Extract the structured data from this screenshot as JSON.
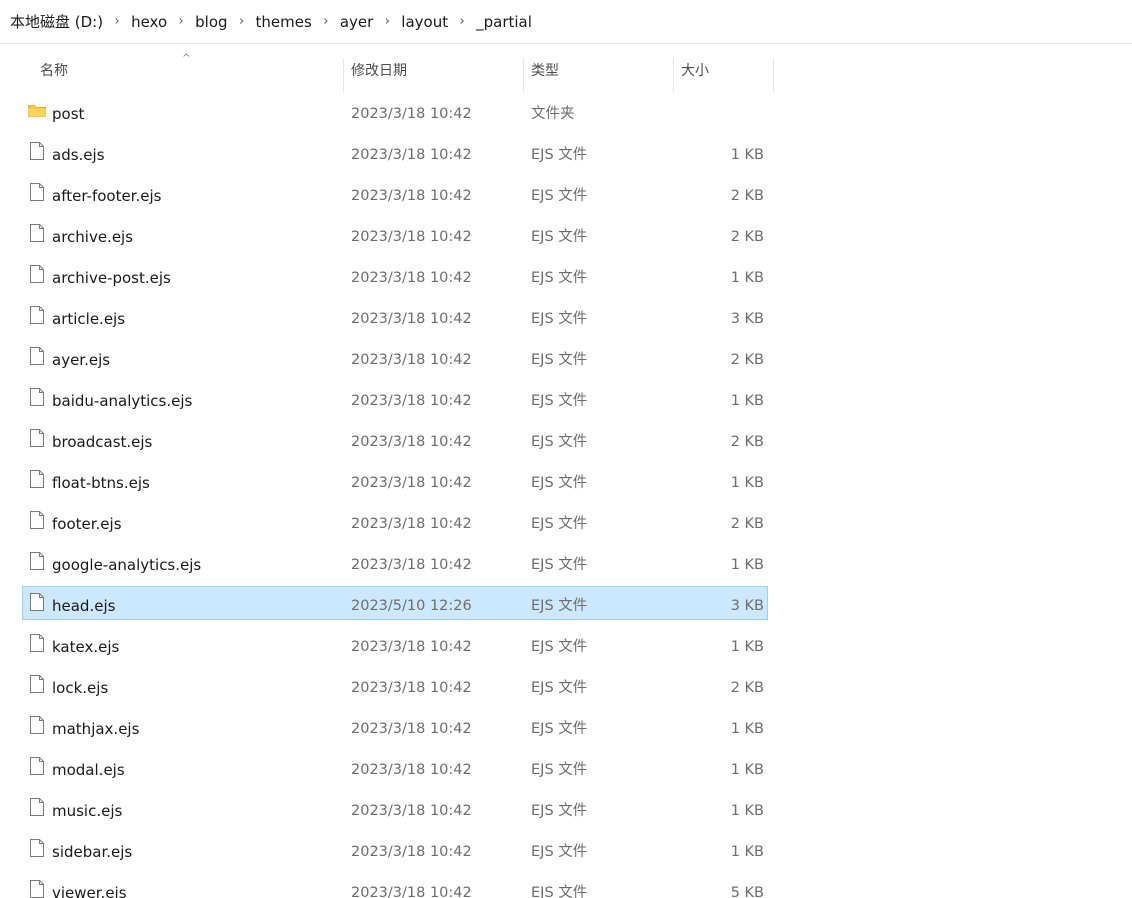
{
  "breadcrumb": {
    "items": [
      "本地磁盘 (D:)",
      "hexo",
      "blog",
      "themes",
      "ayer",
      "layout",
      "_partial"
    ],
    "separator": "›"
  },
  "columns": {
    "name": "名称",
    "date": "修改日期",
    "type": "类型",
    "size": "大小",
    "sort_indicator": "^"
  },
  "colors": {
    "selection_bg": "#cce8ff",
    "selection_border": "#99d1ff",
    "folder": "#f8c644"
  },
  "files": [
    {
      "name": "post",
      "date": "2023/3/18 10:42",
      "type": "文件夹",
      "size": "",
      "icon": "folder-icon"
    },
    {
      "name": "ads.ejs",
      "date": "2023/3/18 10:42",
      "type": "EJS 文件",
      "size": "1 KB",
      "icon": "file-icon"
    },
    {
      "name": "after-footer.ejs",
      "date": "2023/3/18 10:42",
      "type": "EJS 文件",
      "size": "2 KB",
      "icon": "file-icon"
    },
    {
      "name": "archive.ejs",
      "date": "2023/3/18 10:42",
      "type": "EJS 文件",
      "size": "2 KB",
      "icon": "file-icon"
    },
    {
      "name": "archive-post.ejs",
      "date": "2023/3/18 10:42",
      "type": "EJS 文件",
      "size": "1 KB",
      "icon": "file-icon"
    },
    {
      "name": "article.ejs",
      "date": "2023/3/18 10:42",
      "type": "EJS 文件",
      "size": "3 KB",
      "icon": "file-icon"
    },
    {
      "name": "ayer.ejs",
      "date": "2023/3/18 10:42",
      "type": "EJS 文件",
      "size": "2 KB",
      "icon": "file-icon"
    },
    {
      "name": "baidu-analytics.ejs",
      "date": "2023/3/18 10:42",
      "type": "EJS 文件",
      "size": "1 KB",
      "icon": "file-icon"
    },
    {
      "name": "broadcast.ejs",
      "date": "2023/3/18 10:42",
      "type": "EJS 文件",
      "size": "2 KB",
      "icon": "file-icon"
    },
    {
      "name": "float-btns.ejs",
      "date": "2023/3/18 10:42",
      "type": "EJS 文件",
      "size": "1 KB",
      "icon": "file-icon"
    },
    {
      "name": "footer.ejs",
      "date": "2023/3/18 10:42",
      "type": "EJS 文件",
      "size": "2 KB",
      "icon": "file-icon"
    },
    {
      "name": "google-analytics.ejs",
      "date": "2023/3/18 10:42",
      "type": "EJS 文件",
      "size": "1 KB",
      "icon": "file-icon"
    },
    {
      "name": "head.ejs",
      "date": "2023/5/10 12:26",
      "type": "EJS 文件",
      "size": "3 KB",
      "icon": "file-icon",
      "selected": true
    },
    {
      "name": "katex.ejs",
      "date": "2023/3/18 10:42",
      "type": "EJS 文件",
      "size": "1 KB",
      "icon": "file-icon"
    },
    {
      "name": "lock.ejs",
      "date": "2023/3/18 10:42",
      "type": "EJS 文件",
      "size": "2 KB",
      "icon": "file-icon"
    },
    {
      "name": "mathjax.ejs",
      "date": "2023/3/18 10:42",
      "type": "EJS 文件",
      "size": "1 KB",
      "icon": "file-icon"
    },
    {
      "name": "modal.ejs",
      "date": "2023/3/18 10:42",
      "type": "EJS 文件",
      "size": "1 KB",
      "icon": "file-icon"
    },
    {
      "name": "music.ejs",
      "date": "2023/3/18 10:42",
      "type": "EJS 文件",
      "size": "1 KB",
      "icon": "file-icon"
    },
    {
      "name": "sidebar.ejs",
      "date": "2023/3/18 10:42",
      "type": "EJS 文件",
      "size": "1 KB",
      "icon": "file-icon"
    },
    {
      "name": "viewer.ejs",
      "date": "2023/3/18 10:42",
      "type": "EJS 文件",
      "size": "5 KB",
      "icon": "file-icon"
    }
  ]
}
